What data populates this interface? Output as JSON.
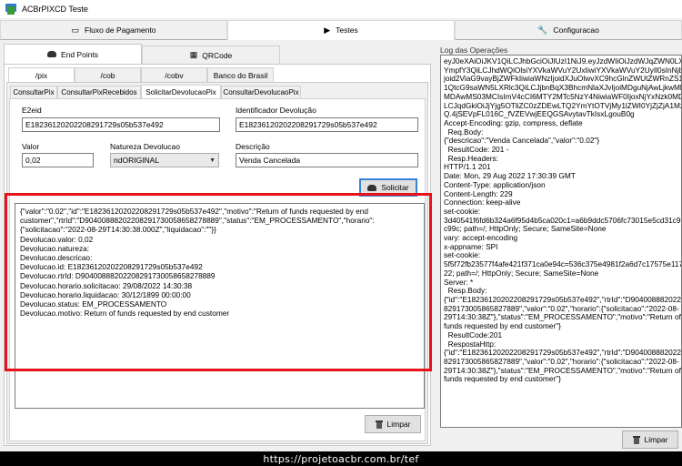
{
  "window": {
    "title": "ACBrPIXCD Teste"
  },
  "main_tabs": [
    {
      "label": "Fluxo de Pagamento",
      "icon": "window-icon"
    },
    {
      "label": "Testes",
      "icon": "play-icon"
    },
    {
      "label": "Configuracao",
      "icon": "wrench-icon"
    }
  ],
  "section_tabs": [
    {
      "label": "End Points",
      "icon": "cloud-icon"
    },
    {
      "label": "QRCode",
      "icon": "qrcode-icon"
    }
  ],
  "endpoint_tabs": [
    "/pix",
    "/cob",
    "/cobv",
    "Banco do Brasil"
  ],
  "operation_tabs": [
    "ConsultarPix",
    "ConsultarPixRecebidos",
    "SolicitarDevolucaoPix",
    "ConsultarDevolucaoPix"
  ],
  "form": {
    "e2eid_label": "E2eid",
    "e2eid_value": "E18236120202208291729s05b537e492",
    "devolucao_id_label": "Identificador Devolução",
    "devolucao_id_value": "E18236120202208291729s05b537e492",
    "valor_label": "Valor",
    "valor_value": "0,02",
    "natureza_label": "Natureza Devolucao",
    "natureza_value": "ndORIGINAL",
    "descricao_label": "Descrição",
    "descricao_value": "Venda Cancelada",
    "solicitar_label": "Solicitar",
    "limpar_label": "Limpar"
  },
  "response_lines": [
    "{\"valor\":\"0.02\",\"id\":\"E18236120202208291729s05b537e492\",\"motivo\":\"Return of funds requested by end",
    "customer\",\"rtrId\":\"D90400888202208291730058658278889\",\"status\":\"EM_PROCESSAMENTO\",\"horario\":",
    "{\"solicitacao\":\"2022-08-29T14:30:38.000Z\",\"liquidacao\":\"\"}}",
    "Devolucao.valor: 0,02",
    "Devolucao.natureza:",
    "Devolucao.descricao:",
    "Devolucao.id: E18236120202208291729s05b537e492",
    "Devolucao.rtrId: D90400888202208291730058658278889",
    "Devolucao.horario.solicitacao: 29/08/2022 14:30:38",
    "Devolucao.horario.liquidacao: 30/12/1899 00:00:00",
    "Devolucao.status: EM_PROCESSAMENTO",
    "Devolucao.motivo: Return of funds requested by end customer"
  ],
  "log": {
    "title": "Log das Operações",
    "lines": [
      "eyJ0eXAiOiJKV1QiLCJhbGciOiJIUzI1NiJ9.eyJzdWIiOiJzdWJqZWN0LXN1",
      "YmpfY3QiLCJhdWQiOlsiYXVkaWVuY2UxIiwiYXVkaWVuY2UyIl0sInNjb3Bl",
      "joid2ViaG9vayBjZWFkIiwiaWNzIjoidXJuOlwvXC9hcGlnZWUtZWRnZS1hY",
      "1QtcG9saWN5LXRlc3QiLCJjbnBqX3BhcmNlaXJvIjoiMDguNjAwLjkwMkw",
      "MDAwMS03MCIsImV4cCI6MTY2MTc5NzY4NiwiaWF0IjoxNjYxNzk0MDg",
      "LCJqdGkiOiJjYjg5OTliZC0zZDEwLTQ2YmYtOTVjMy1lZWI0YjZjZjA1Mzci",
      "Q.4jSEVpFL016C_fVZEVwjEEQGSAvytavTkIsxLgouB0g",
      "Accept-Encoding: gzip, compress, deflate",
      "",
      "  Req.Body:",
      "{\"descricao\":\"Venda Cancelada\",\"valor\":\"0.02\"}",
      "  ResultCode: 201 -",
      "  Resp.Headers:",
      "HTTP/1.1 201",
      "Date: Mon, 29 Aug 2022 17:30:39 GMT",
      "Content-Type: application/json",
      "Content-Length: 229",
      "Connection: keep-alive",
      "set-cookie:",
      "3d40541f6fd6b324a6f95d4b5ca020c1=a6b9ddc5706fc73015e5cd31c9e",
      "c99c; path=/; HttpOnly; Secure; SameSite=None",
      "vary: accept-encoding",
      "x-appname: SPI",
      "set-cookie:",
      "5f5f72fb23577f4afe421f371ca0e94c=536c375e4981f2a6d7c17575e117",
      "22; path=/; HttpOnly; Secure; SameSite=None",
      "Server: *",
      "",
      "",
      "  Resp.Body:",
      "{\"id\":\"E18236120202208291729s05b537e492\",\"rtrId\":\"D9040088820220",
      "829173005865827889\",\"valor\":\"0.02\",\"horario\":{\"solicitacao\":\"2022-08-",
      "29T14:30:38Z\"},\"status\":\"EM_PROCESSAMENTO\",\"motivo\":\"Return of",
      "funds requested by end customer\"}",
      "  ResultCode:201",
      "  RespostaHttp:",
      "{\"id\":\"E18236120202208291729s05b537e492\",\"rtrId\":\"D9040088820220",
      "829173005865827889\",\"valor\":\"0.02\",\"horario\":{\"solicitacao\":\"2022-08-",
      "29T14:30:38Z\"},\"status\":\"EM_PROCESSAMENTO\",\"motivo\":\"Return of",
      "funds requested by end customer\"}"
    ],
    "limpar_label": "Limpar"
  },
  "banner": {
    "text": "https://projetoacbr.com.br/tef"
  },
  "colors": {
    "highlight_frame": "#e8121b",
    "focus_border": "#3a82d6"
  }
}
